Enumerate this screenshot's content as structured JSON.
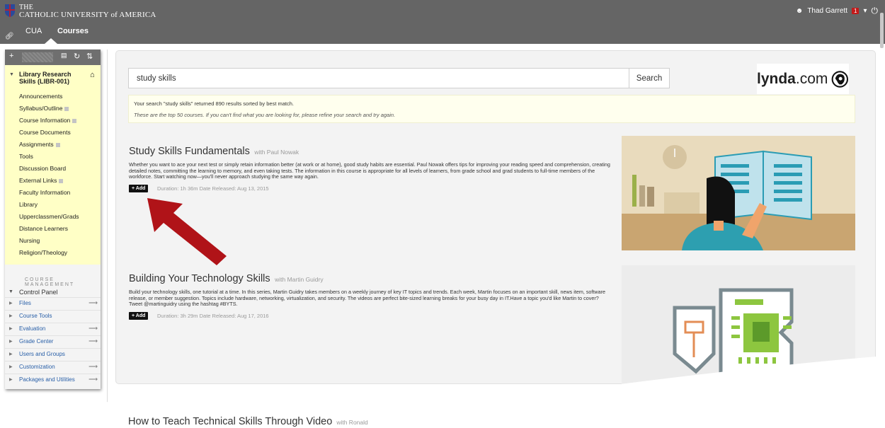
{
  "header": {
    "university_line1": "THE",
    "university_line2": "CATHOLIC UNIVERSITY of AMERICA",
    "tabs": [
      {
        "label": "CUA"
      },
      {
        "label": "Courses"
      }
    ],
    "user_name": "Thad Garrett",
    "notification_count": "1",
    "crest_color": "#b22234"
  },
  "sidebar": {
    "course_title": "Library Research Skills (LIBR-001)",
    "menu_items": [
      {
        "label": "Announcements"
      },
      {
        "label": "Syllabus/Outline"
      },
      {
        "label": "Course Information"
      },
      {
        "label": "Course Documents"
      },
      {
        "label": "Assignments"
      },
      {
        "label": "Tools"
      },
      {
        "label": "Discussion Board"
      },
      {
        "label": "External Links"
      },
      {
        "label": "Faculty Information"
      },
      {
        "label": "Library"
      },
      {
        "label": "Upperclassmen/Grads"
      },
      {
        "label": "Distance Learners"
      },
      {
        "label": "Nursing"
      },
      {
        "label": "Religion/Theology"
      }
    ],
    "management_heading": "COURSE MANAGEMENT",
    "control_panel_label": "Control Panel",
    "management_items": [
      {
        "label": "Files"
      },
      {
        "label": "Course Tools"
      },
      {
        "label": "Evaluation"
      },
      {
        "label": "Grade Center"
      },
      {
        "label": "Users and Groups"
      },
      {
        "label": "Customization"
      },
      {
        "label": "Packages and Utilities"
      }
    ]
  },
  "search": {
    "value": "study skills",
    "button_label": "Search",
    "results_line": "Your search \"study skills\" returned 890 results sorted by best match.",
    "refine_line": "These are the top 50 courses. If you can't find what you are looking for, please refine your search and try again."
  },
  "brand": {
    "name_bold": "lynda",
    "name_rest": ".com"
  },
  "courses": [
    {
      "title": "Study Skills Fundamentals",
      "author": "with Paul Nowak",
      "description": "Whether you want to ace your next test or simply retain information better (at work or at home), good study habits are essential. Paul Nowak offers tips for improving your reading speed and comprehension, creating detailed notes, committing the learning to memory, and even taking tests. The information in this course is appropriate for all levels of learners, from grade school and grad students to full-time members of the workforce. Start watching now—you'll never approach studying the same way again.",
      "add_label": "+ Add",
      "meta": "Duration: 1h 36m    Date Released: Aug 13, 2015"
    },
    {
      "title": "Building Your Technology Skills",
      "author": "with Martin Guidry",
      "description": "Build your technology skills, one tutorial at a time. In this series, Martin Guidry takes members on a weekly journey of key IT topics and trends. Each week, Martin focuses on an important skill, news item, software release, or member suggestion. Topics include hardware, networking, virtualization, and security. The videos are perfect bite-sized learning breaks for your busy day in IT.Have a topic you'd like Martin to cover? Tweet @martinguidry using the hashtag #BYTS.",
      "add_label": "+ Add",
      "meta": "Duration: 3h 29m    Date Released: Aug 17, 2016"
    },
    {
      "title": "How to Teach Technical Skills Through Video",
      "author": "with Ronald"
    }
  ],
  "colors": {
    "topbar": "#656565",
    "course_menu_bg": "#ffffc6",
    "arrow": "#b01318",
    "thumb1_bg": "#e9dbbd",
    "thumb2_bg": "#ececec"
  }
}
